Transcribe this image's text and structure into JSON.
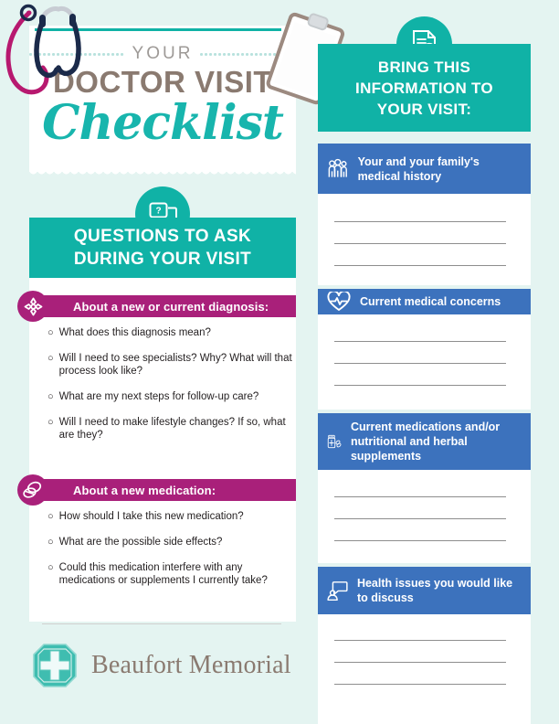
{
  "theme": {
    "background": "#e4f4f1",
    "teal": "#10b2a6",
    "blue": "#3c72bd",
    "magenta": "#a9207a",
    "taupe": "#8a7a70",
    "script_teal": "#18b5ad",
    "line_gray": "#8e8e8e"
  },
  "title": {
    "kicker": "YOUR",
    "main": "DOCTOR VISIT",
    "script": "Checklist",
    "decor_icons": [
      "stethoscope-magenta",
      "stethoscope-navy",
      "clipboard"
    ]
  },
  "questions_panel": {
    "header_icon": "question-speech-bubble-icon",
    "header": "QUESTIONS TO ASK\nDURING YOUR VISIT",
    "header_line1": "QUESTIONS TO ASK",
    "header_line2": "DURING YOUR VISIT",
    "sections": [
      {
        "icon": "star-of-life-icon",
        "label": "About a new or current diagnosis:",
        "bullet": "○",
        "items": [
          "What does this diagnosis mean?",
          "Will I need to see specialists? Why? What will that process look like?",
          "What are my next steps for follow-up care?",
          "Will I need to make lifestyle changes? If so, what are they?"
        ]
      },
      {
        "icon": "pills-icon",
        "label": "About a new medication:",
        "bullet": "○",
        "items": [
          "How should I take this new medication?",
          "What are the possible side effects?",
          "Could this medication interfere with any medications or supplements I currently take?"
        ]
      }
    ]
  },
  "bring_panel": {
    "header_icon": "document-search-icon",
    "header_line1": "BRING THIS",
    "header_line2": "INFORMATION TO",
    "header_line3": "YOUR VISIT:",
    "sections": [
      {
        "icon": "family-group-icon",
        "label": "Your and your family's medical history",
        "write_lines": 3
      },
      {
        "icon": "heart-pulse-icon",
        "label": "Current medical concerns",
        "write_lines": 3
      },
      {
        "icon": "pill-bottle-icon",
        "label": "Current medications and/or nutritional and herbal supplements",
        "write_lines": 3
      },
      {
        "icon": "person-speech-bubble-icon",
        "label": "Health issues you would like to discuss",
        "write_lines": 3
      }
    ]
  },
  "footer": {
    "logo_icon": "medical-cross-octagon-icon",
    "brand": "Beaufort Memorial"
  }
}
